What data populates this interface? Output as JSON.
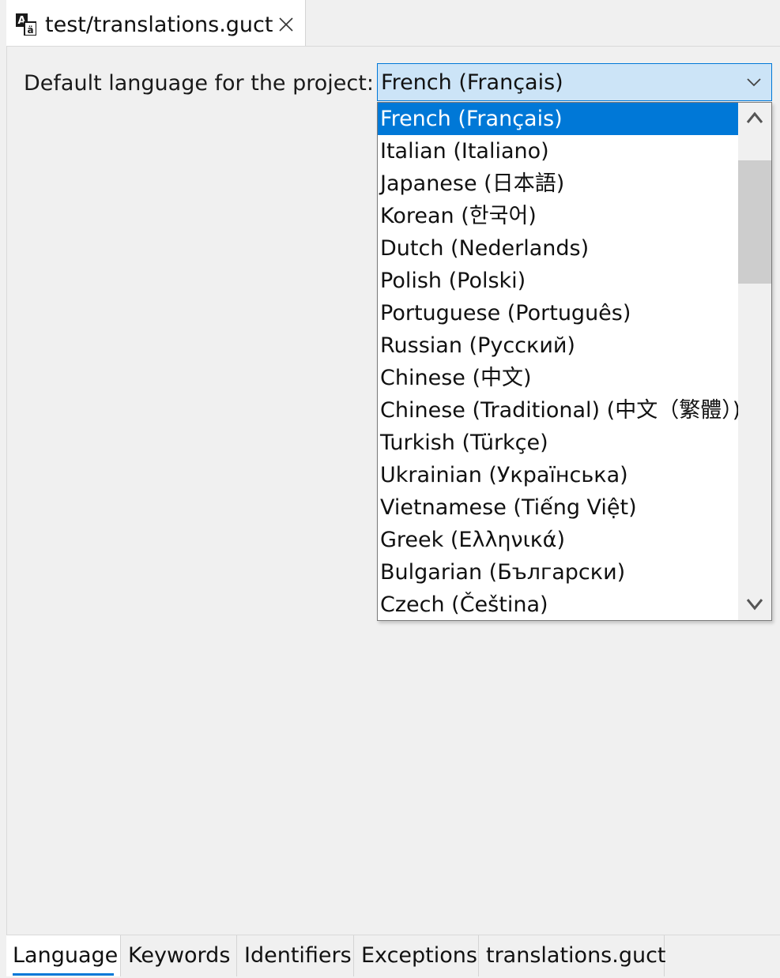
{
  "editor_tab": {
    "icon": "translation-icon",
    "title": "test/translations.guct",
    "close_icon": "close-icon"
  },
  "form": {
    "label": "Default language for the project:",
    "selected_value": "French (Français)"
  },
  "dropdown": {
    "options": [
      "French (Français)",
      "Italian (Italiano)",
      "Japanese (日本語)",
      "Korean (한국어)",
      "Dutch (Nederlands)",
      "Polish (Polski)",
      "Portuguese (Português)",
      "Russian (Русский)",
      "Chinese (中文)",
      "Chinese (Traditional) (中文（繁體）)",
      "Turkish (Türkçe)",
      "Ukrainian (Українська)",
      "Vietnamese (Tiếng Việt)",
      "Greek (Ελληνικά)",
      "Bulgarian (Български)",
      "Czech (Čeština)"
    ],
    "selected_index": 0,
    "scroll_up_icon": "chevron-up-icon",
    "scroll_down_icon": "chevron-down-icon"
  },
  "page_tabs": [
    "Language",
    "Keywords",
    "Identifiers",
    "Exceptions",
    "translations.guct"
  ],
  "active_page_tab": 0,
  "colors": {
    "accent": "#0078d7",
    "combo_background": "#cce4f7",
    "background": "#f0f0f0"
  }
}
